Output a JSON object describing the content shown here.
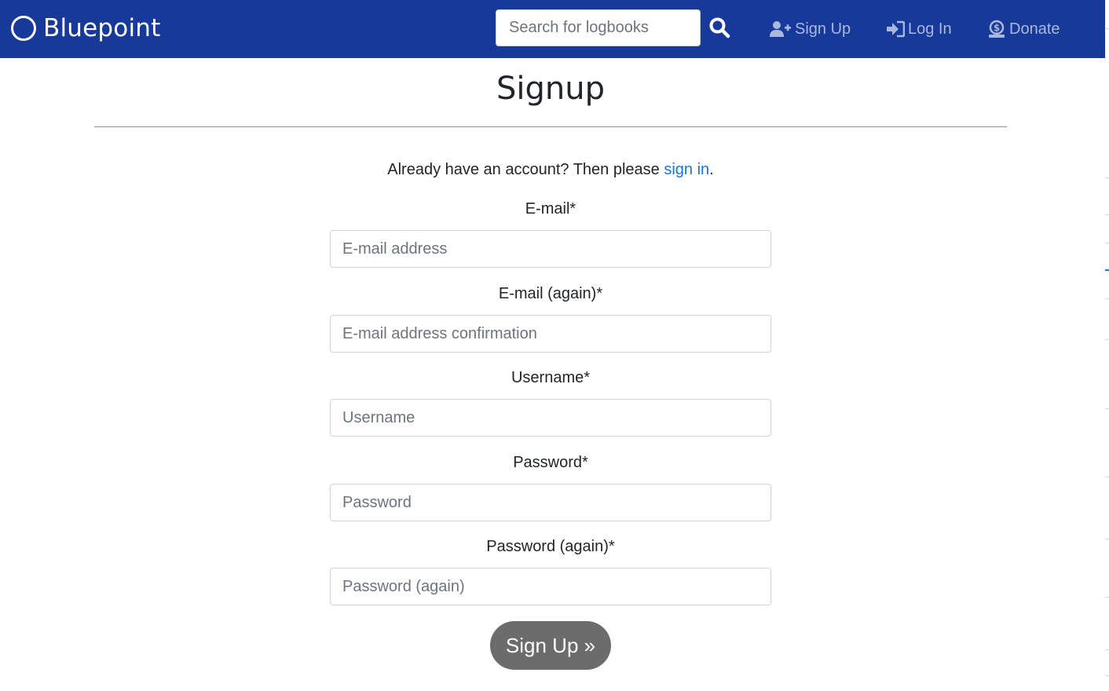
{
  "navbar": {
    "brand": "Bluepoint",
    "search": {
      "placeholder": "Search for logbooks",
      "value": ""
    },
    "links": {
      "signup": "Sign Up",
      "login": "Log In",
      "donate": "Donate"
    },
    "colors": {
      "background": "#17399a",
      "link": "#aab8dd"
    }
  },
  "page": {
    "title": "Signup",
    "signin_prefix": "Already have an account? Then please ",
    "signin_link": "sign in",
    "signin_suffix": "."
  },
  "form": {
    "fields": [
      {
        "label": "E-mail*",
        "placeholder": "E-mail address",
        "value": ""
      },
      {
        "label": "E-mail (again)*",
        "placeholder": "E-mail address confirmation",
        "value": ""
      },
      {
        "label": "Username*",
        "placeholder": "Username",
        "value": ""
      },
      {
        "label": "Password*",
        "placeholder": "Password",
        "value": ""
      },
      {
        "label": "Password (again)*",
        "placeholder": "Password (again)",
        "value": ""
      }
    ],
    "submit": "Sign Up »"
  },
  "icons": {
    "brand": "circle-logo-icon",
    "search": "search-icon",
    "signup": "user-plus-icon",
    "login": "sign-in-icon",
    "donate": "donate-icon"
  },
  "colors": {
    "link": "#1a73d9",
    "submit_bg": "#6c6c6c"
  }
}
